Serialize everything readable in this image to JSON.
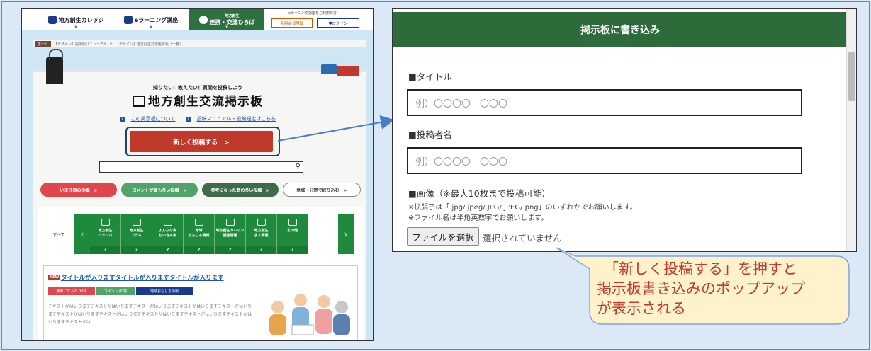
{
  "left_screen": {
    "nav": {
      "college": "地方創生カレッジ",
      "elearning": "eラーニング講座",
      "plaza_small": "地方創生",
      "plaza": "連携・交流ひろば",
      "elearning_note": "eラーニング講座をご利用の方",
      "register": "無料会員登録",
      "login": "ログイン"
    },
    "breadcrumb": [
      "ホーム",
      "【デザイン】掲示板リニューアル",
      ">",
      "【デザイン】地方創生交流掲示板（一覧）"
    ],
    "subtitle": "知りたい！教えたい！質問を投稿しよう",
    "title": "地方創生交流掲示板",
    "link_about": "この掲示板について",
    "link_manual": "投稿マニュアル・投稿規定はこちら",
    "post_button": "新しく投稿する　>",
    "filters": [
      "いま注目の投稿　>",
      "コメントが最も多い投稿　>",
      "参考になった数の多い投稿　>",
      "地域・分野で絞り込む　>"
    ],
    "category_all": "すべて",
    "categories": [
      {
        "label": "地方創生\nハモリパ",
        "q": "?"
      },
      {
        "label": "地方創生\nコラム",
        "q": "?"
      },
      {
        "label": "よんなな会\nちいきん会",
        "q": "?"
      },
      {
        "label": "地域\nおもしろ情報",
        "q": "?"
      },
      {
        "label": "地方創生カレッジ\n講座情報",
        "q": "?"
      },
      {
        "label": "地方創生\n求人情報",
        "q": "?"
      },
      {
        "label": "その他",
        "q": "?"
      }
    ],
    "article": {
      "badge": "NEW",
      "title": "タイトルが入りますタイトルが入りますタイトルが入ります",
      "tag_helpful": "参考になった 00件",
      "tag_comment": "コメント 00件",
      "tag_category": "地域おもしろ情報",
      "body": "テキストがはいりますテキストがはいりますテキストがはいりますテキストがはいりますテキストがはいりますテキストがはいりますテキストがはいりますテキストがはいりますテキストがはいりますテキストがはいりますテキストがは..."
    }
  },
  "modal": {
    "header": "掲示板に書き込み",
    "title_label": "■タイトル",
    "title_placeholder": "例）〇〇〇〇　〇〇〇",
    "author_label": "■投稿者名",
    "author_placeholder": "例）〇〇〇〇　〇〇〇",
    "image_label": "■画像（※最大10枚まで投稿可能）",
    "note1": "※拡張子は「.jpg/.jpeg/.JPG/.JPEG/.png」のいずれかでお願いします。",
    "note2": "※ファイル名は半角英数字でお願いします。",
    "file_button": "ファイルを選択",
    "file_status": "選択されていません"
  },
  "callout": {
    "line1": "「新しく投稿する」を押すと",
    "line2": "掲示板書き込みのポップアップ",
    "line3": "が表示される"
  },
  "colors": {
    "accent_red": "#c0392b",
    "green": "#2e6b3a",
    "callout_fill": "#fdf2cc",
    "callout_border": "#7ea6d8"
  }
}
